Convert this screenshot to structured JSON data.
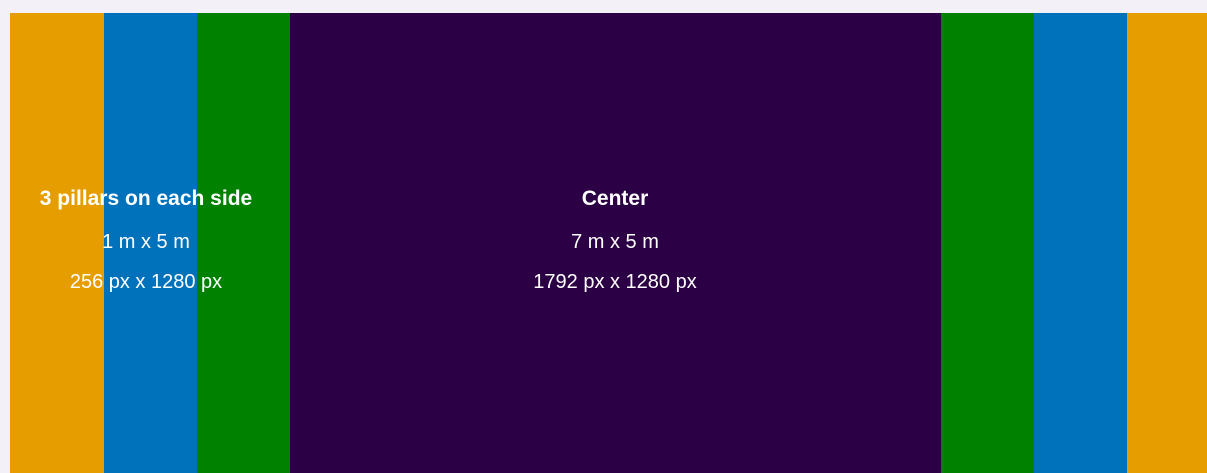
{
  "colors": {
    "orange": "#e69d00",
    "blue": "#0072bc",
    "green": "#008100",
    "center": "#2c0045",
    "text": "#ffffff"
  },
  "bands": [
    {
      "name": "left-pillar-outer",
      "color": "#e69d00"
    },
    {
      "name": "left-pillar-middle",
      "color": "#0072bc"
    },
    {
      "name": "left-pillar-inner",
      "color": "#008100"
    },
    {
      "name": "center-section",
      "color": "#2c0045"
    },
    {
      "name": "right-pillar-inner",
      "color": "#008100"
    },
    {
      "name": "right-pillar-middle",
      "color": "#0072bc"
    },
    {
      "name": "right-pillar-outer",
      "color": "#e69d00"
    }
  ],
  "pillars": {
    "title": "3 pillars on each side",
    "size_m": "1 m x 5 m",
    "size_px": "256 px x 1280 px"
  },
  "center": {
    "title": "Center",
    "size_m": "7 m x 5 m",
    "size_px": "1792 px x 1280 px"
  }
}
